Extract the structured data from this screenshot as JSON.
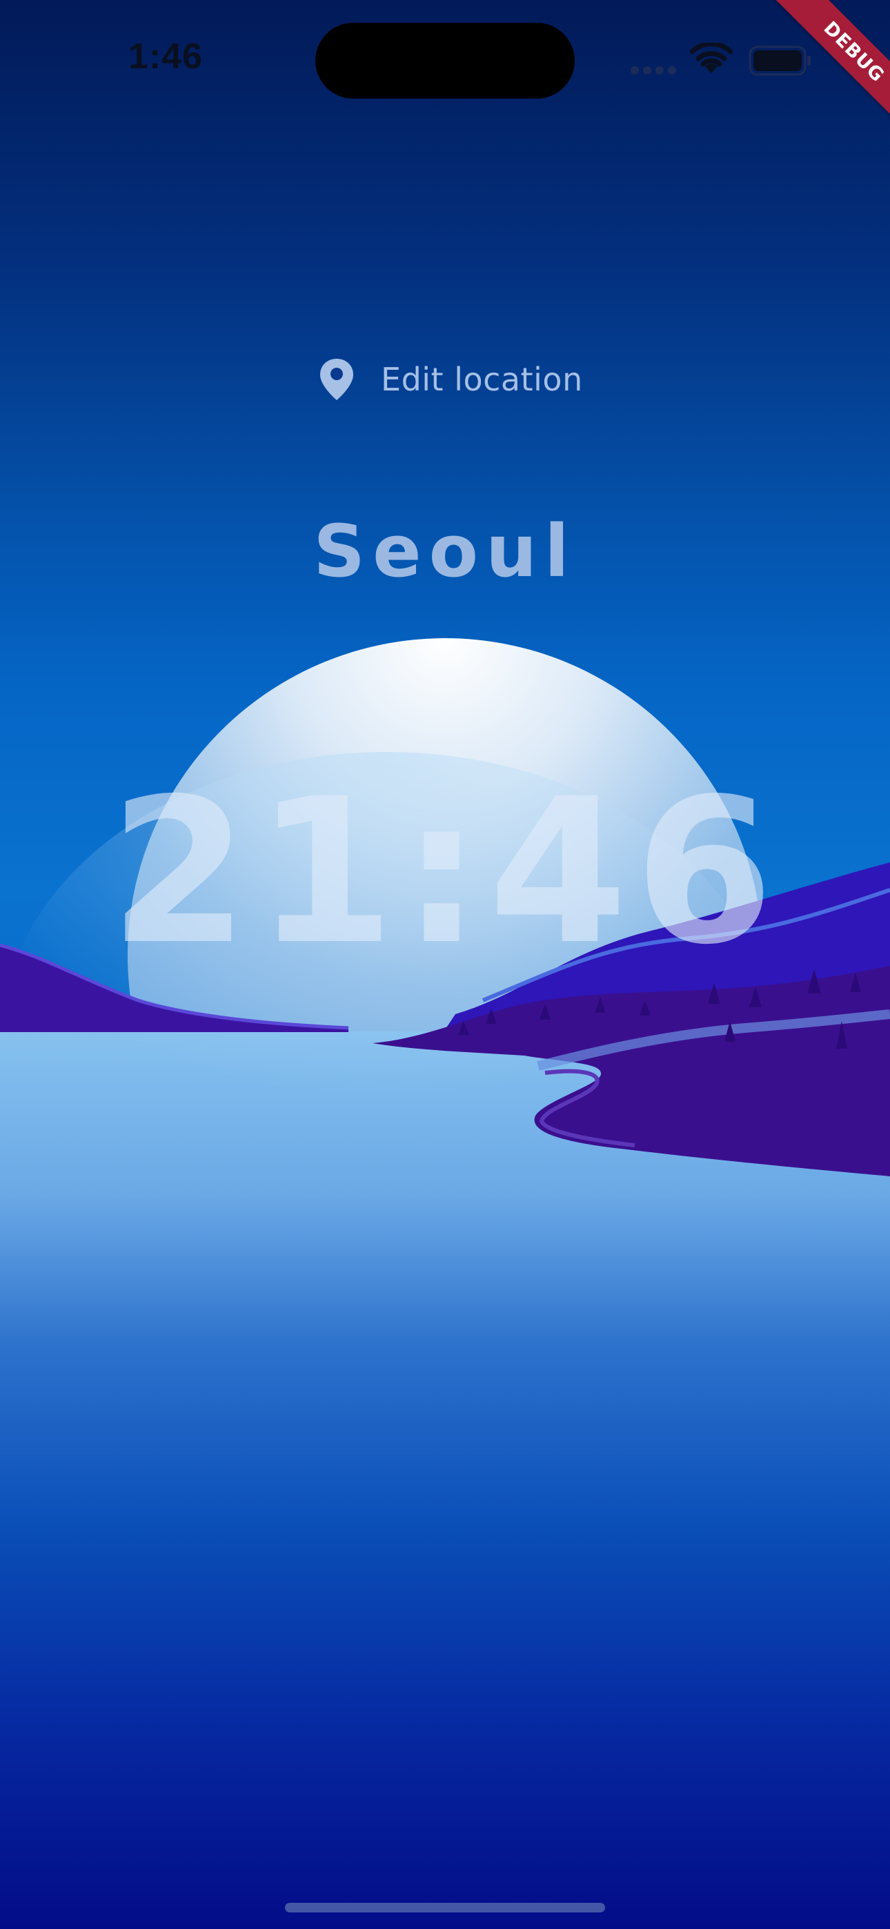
{
  "status_bar": {
    "time": "1:46",
    "icons": [
      "signal-icon",
      "wifi-icon",
      "battery-icon"
    ]
  },
  "debug_banner": "DEBUG",
  "location_button": {
    "icon": "location-pin-icon",
    "label": "Edit location"
  },
  "city": "Seoul",
  "local_time": "21:46",
  "colors": {
    "sky_top": "#021a58",
    "sky_mid": "#0566c6",
    "hills": "#3a14a0",
    "water_light": "#8ec4ee",
    "water_deep": "#030f8a",
    "debug_ribbon": "#a51d38",
    "label_text": "#a6c0e6"
  }
}
